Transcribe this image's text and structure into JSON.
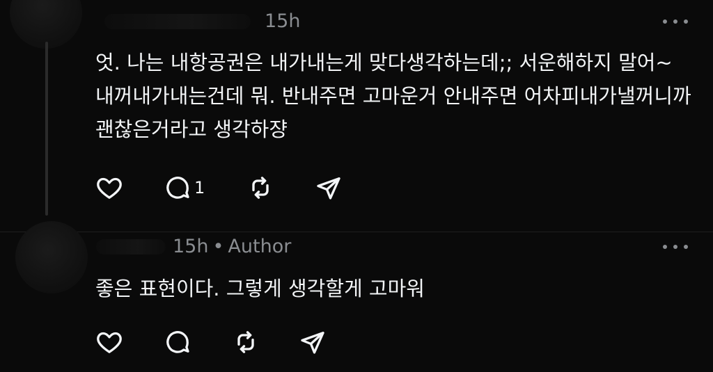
{
  "posts": [
    {
      "time": "15h",
      "author_tag": "",
      "text": "엇. 나는 내항공권은 내가내는게 맞다생각하는데;; 서운해하지 말어~ 내꺼내가내는건데 뭐. 반내주면 고마운거 안내주면 어차피내가낼꺼니까 괜찮은거라고 생각하쟝",
      "actions": {
        "like_icon": "heart-icon",
        "reply_icon": "comment-icon",
        "reply_count": "1",
        "repost_icon": "repost-icon",
        "share_icon": "send-icon"
      }
    },
    {
      "time": "15h",
      "separator": "•",
      "author_tag": "Author",
      "text": "좋은 표현이다. 그렇게 생각할게 고마워",
      "actions": {
        "like_icon": "heart-icon",
        "reply_icon": "comment-icon",
        "reply_count": "",
        "repost_icon": "repost-icon",
        "share_icon": "send-icon"
      }
    }
  ],
  "more_icon": "more-horizontal-icon",
  "colors": {
    "background": "#0a0a0a",
    "text": "#f3f5f7",
    "meta": "#8a8d91"
  }
}
